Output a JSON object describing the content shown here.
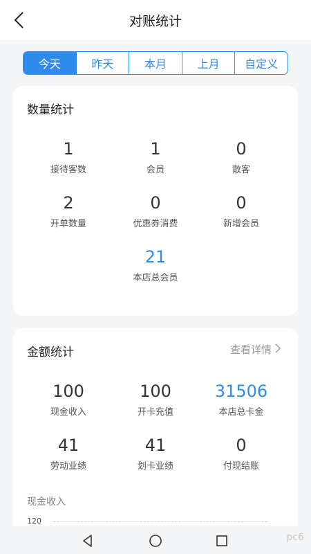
{
  "header": {
    "title": "对账统计"
  },
  "tabs": [
    {
      "label": "今天",
      "active": true
    },
    {
      "label": "昨天"
    },
    {
      "label": "本月"
    },
    {
      "label": "上月"
    },
    {
      "label": "自定义"
    }
  ],
  "quantity": {
    "title": "数量统计",
    "items": [
      {
        "value": "1",
        "label": "接待客数"
      },
      {
        "value": "1",
        "label": "会员"
      },
      {
        "value": "0",
        "label": "散客"
      },
      {
        "value": "2",
        "label": "开单数量"
      },
      {
        "value": "0",
        "label": "优惠券消费"
      },
      {
        "value": "0",
        "label": "新增会员"
      },
      {
        "value": "21",
        "label": "本店总会员"
      }
    ]
  },
  "amount": {
    "title": "金额统计",
    "detail_label": "查看详情",
    "items": [
      {
        "value": "100",
        "label": "现金收入"
      },
      {
        "value": "100",
        "label": "开卡充值"
      },
      {
        "value": "31506",
        "label": "本店总卡金"
      },
      {
        "value": "41",
        "label": "劳动业绩"
      },
      {
        "value": "41",
        "label": "划卡业绩"
      },
      {
        "value": "0",
        "label": "付现结账"
      }
    ],
    "chart_title": "现金收入",
    "chart_y_max": "120"
  },
  "watermark": "pc6",
  "colors": {
    "accent": "#2f8bea"
  }
}
